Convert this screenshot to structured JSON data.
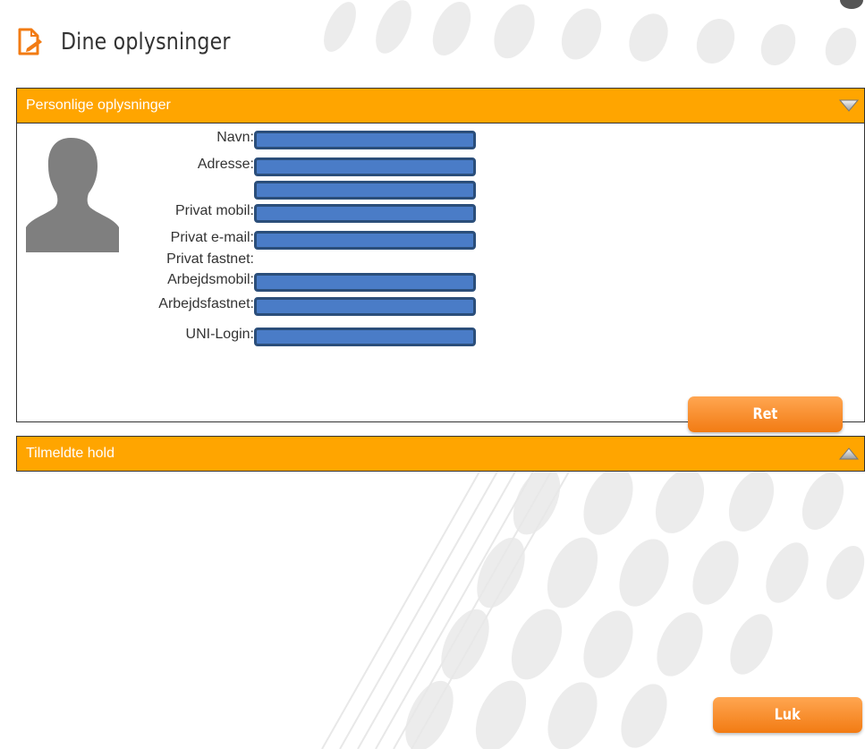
{
  "header": {
    "title": "Dine oplysninger",
    "icon": "document-edit-icon"
  },
  "personal_panel": {
    "title": "Personlige oplysninger",
    "toggle_icon": "triangle-down-icon",
    "fields": [
      {
        "label": "Navn:",
        "value": "",
        "has_input": true
      },
      {
        "label": "Adresse:",
        "value": "",
        "has_input": true
      },
      {
        "label": "",
        "value": "",
        "has_input": true
      },
      {
        "label": "Privat mobil:",
        "value": "",
        "has_input": true
      },
      {
        "label": "Privat e-mail:",
        "value": "",
        "has_input": true
      },
      {
        "label": "Privat fastnet:",
        "value": "",
        "has_input": false
      },
      {
        "label": "Arbejdsmobil:",
        "value": "",
        "has_input": true
      },
      {
        "label": "Arbejdsfastnet:",
        "value": "",
        "has_input": true
      },
      {
        "label": "UNI-Login:",
        "value": "",
        "has_input": true
      }
    ],
    "edit_button": "Ret"
  },
  "courses_panel": {
    "title": "Tilmeldte hold",
    "toggle_icon": "triangle-up-icon"
  },
  "close_button": "Luk",
  "colors": {
    "accent": "#ffa500",
    "button": "#f27b13",
    "field_fill": "#4a7cc7",
    "field_border": "#2b4e7a"
  }
}
